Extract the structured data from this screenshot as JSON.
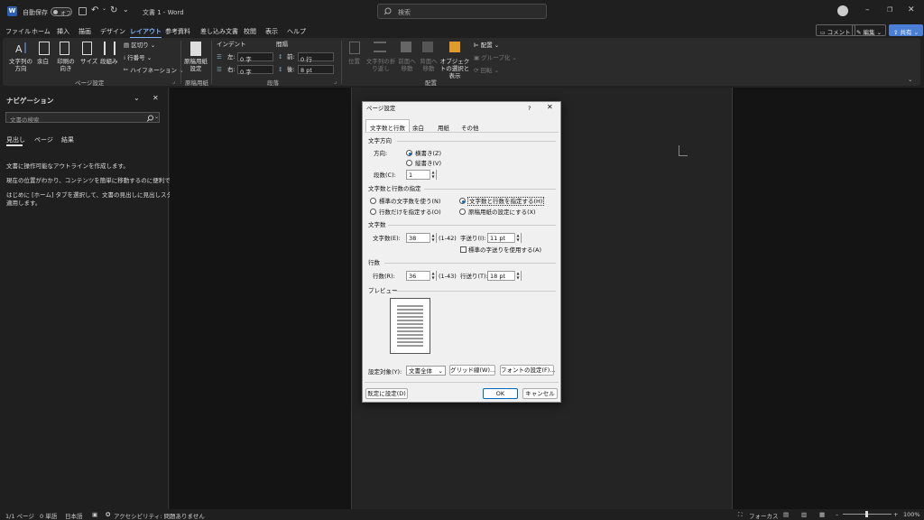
{
  "titlebar": {
    "autosave_label": "自動保存",
    "autosave_state": "オフ",
    "doc_title": "文書 1 - Word",
    "search_placeholder": "検索"
  },
  "menu": {
    "tabs": [
      "ファイル",
      "ホーム",
      "挿入",
      "描画",
      "デザイン",
      "レイアウト",
      "参考資料",
      "差し込み文書",
      "校閲",
      "表示",
      "ヘルプ"
    ],
    "active_tab": "レイアウト",
    "comment_button": "コメント",
    "edit_button": "編集",
    "share_button": "共有"
  },
  "ribbon": {
    "text_direction": "文字列の方向",
    "margins": "余白",
    "orientation": "印刷の向き",
    "size": "サイズ",
    "columns": "段組み",
    "breaks": "区切り",
    "line_numbers": "行番号",
    "hyphenation": "ハイフネーション",
    "page_setup_group": "ページ設定",
    "genko": "原稿用紙設定",
    "genko_group": "原稿用紙",
    "indent_header": "インデント",
    "spacing_header": "間隔",
    "indent_left_label": "左:",
    "indent_left_value": "0 字",
    "indent_right_label": "右:",
    "indent_right_value": "0 字",
    "space_before_label": "前:",
    "space_before_value": "0 行",
    "space_after_label": "後:",
    "space_after_value": "8 pt",
    "paragraph_group": "段落",
    "position": "位置",
    "wrap_text": "文字列の折り返し",
    "bring_forward": "前面へ移動",
    "send_backward": "背面へ移動",
    "selection_pane": "オブジェクトの選択と表示",
    "align": "配置",
    "group": "グループ化",
    "rotate": "回転",
    "arrange_group": "配置"
  },
  "nav": {
    "title": "ナビゲーション",
    "search_placeholder": "文書の検索",
    "tabs": [
      "見出し",
      "ページ",
      "結果"
    ],
    "active_tab": "見出し",
    "para1": "文書に操作可能なアウトラインを作成します。",
    "para2": "現在の位置がわかり、コンテンツを簡単に移動するのに便利です。",
    "para3_line1": "はじめに [ホーム] タブを選択して、文書の見出しに見出しスタイルを",
    "para3_line2": "適用します。"
  },
  "dialog": {
    "title": "ページ設定",
    "help": "?",
    "tabs": [
      "文字数と行数",
      "余白",
      "用紙",
      "その他"
    ],
    "active_tab": "文字数と行数",
    "text_dir_header": "文字方向",
    "direction_label": "方向:",
    "horizontal": "横書き(Z)",
    "vertical": "縦書き(V)",
    "columns_label": "段数(C):",
    "columns_value": "1",
    "grid_header": "文字数と行数の指定",
    "opt_standard": "標準の文字数を使う(N)",
    "opt_chars_lines": "文字数と行数を指定する(H)",
    "opt_lines_only": "行数だけを指定する(O)",
    "opt_genko": "原稿用紙の設定にする(X)",
    "chars_header": "文字数",
    "chars_label": "文字数(E):",
    "chars_value": "38",
    "chars_range": "(1-42)",
    "char_pitch_label": "字送り(I):",
    "char_pitch_value": "11 pt",
    "use_default_pitch": "標準の字送りを使用する(A)",
    "lines_header": "行数",
    "lines_label": "行数(R):",
    "lines_value": "36",
    "lines_range": "(1-43)",
    "line_pitch_label": "行送り(T):",
    "line_pitch_value": "18 pt",
    "preview_header": "プレビュー",
    "apply_to_label": "設定対象(Y):",
    "apply_to_value": "文書全体",
    "grid_button": "グリッド線(W)...",
    "font_button": "フォントの設定(F)...",
    "default_button": "既定に設定(D)",
    "ok_button": "OK",
    "cancel_button": "キャンセル"
  },
  "status": {
    "page": "1/1 ページ",
    "words": "0 単語",
    "language": "日本語",
    "accessibility": "アクセシビリティ: 問題ありません",
    "focus": "フォーカス",
    "zoom": "100%"
  }
}
